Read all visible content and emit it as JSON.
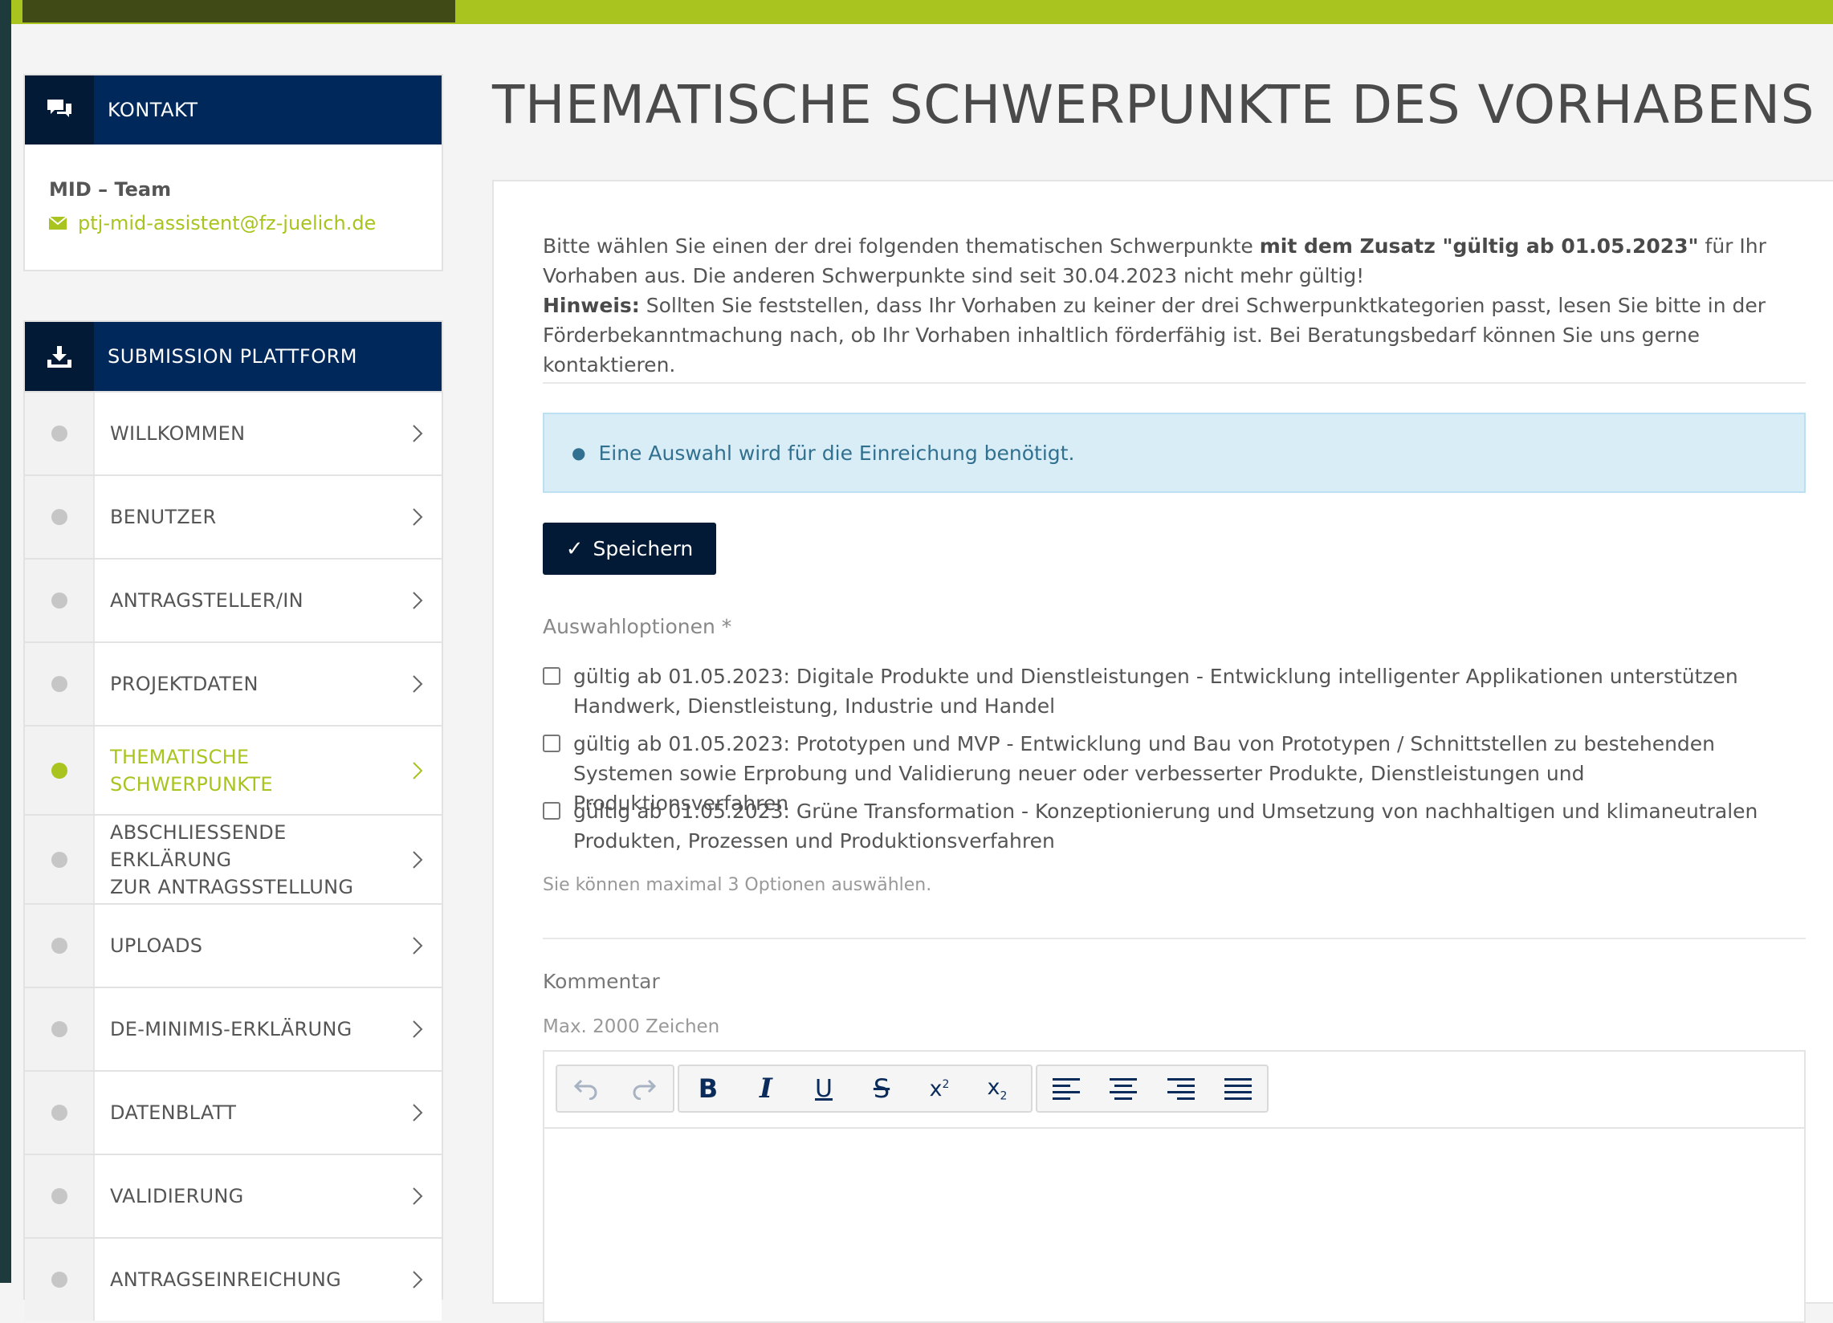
{
  "contact": {
    "header": "KONTAKT",
    "team": "MID – Team",
    "email": "ptj-mid-assistent@fz-juelich.de"
  },
  "submission": {
    "header": "SUBMISSION PLATTFORM",
    "items": [
      {
        "line1": "WILLKOMMEN",
        "line2": ""
      },
      {
        "line1": "BENUTZER",
        "line2": ""
      },
      {
        "line1": "ANTRAGSTELLER/IN",
        "line2": ""
      },
      {
        "line1": "PROJEKTDATEN",
        "line2": ""
      },
      {
        "line1": "THEMATISCHE",
        "line2": "SCHWERPUNKTE"
      },
      {
        "line1": "ABSCHLIESSENDE ERKLÄRUNG",
        "line2": "ZUR ANTRAGSSTELLUNG"
      },
      {
        "line1": "UPLOADS",
        "line2": ""
      },
      {
        "line1": "DE-MINIMIS-ERKLÄRUNG",
        "line2": ""
      },
      {
        "line1": "DATENBLATT",
        "line2": ""
      },
      {
        "line1": "VALIDIERUNG",
        "line2": ""
      },
      {
        "line1": "ANTRAGSEINREICHUNG",
        "line2": ""
      }
    ],
    "active_index": 4
  },
  "main": {
    "title": "THEMATISCHE SCHWERPUNKTE DES VORHABENS",
    "intro": {
      "p1_start": "Bitte wählen Sie einen der drei folgenden thematischen Schwerpunkte ",
      "p1_bold": "mit dem Zusatz \"gültig ab 01.05.2023\"",
      "p1_end": " für Ihr Vorhaben aus. Die anderen Schwerpunkte sind seit 30.04.2023 nicht mehr gültig!",
      "hint_label": "Hinweis:",
      "hint_text": " Sollten Sie feststellen, dass Ihr Vorhaben zu keiner der drei Schwerpunktkategorien passt, lesen Sie bitte in der Förderbekanntmachung nach, ob Ihr Vorhaben inhaltlich förderfähig ist. Bei Beratungsbedarf können Sie uns gerne kontaktieren."
    },
    "alert": "Eine Auswahl wird für die Einreichung benötigt.",
    "save_label": "Speichern",
    "options_label": "Auswahloptionen *",
    "options": [
      "gültig ab 01.05.2023: Digitale Produkte und Dienstleistungen - Entwicklung intelligenter Applikationen unterstützen Handwerk, Dienstleistung, Industrie und Handel",
      "gültig ab 01.05.2023: Prototypen und MVP - Entwicklung und Bau von Prototypen / Schnittstellen zu bestehenden Systemen sowie Erprobung und Validierung neuer oder verbesserter Produkte, Dienstleistungen und Produktionsverfahren",
      "gültig ab 01.05.2023: Grüne Transformation - Konzeptionierung und Umsetzung von nachhaltigen und klimaneutralen Produkten, Prozessen und Produktionsverfahren"
    ],
    "options_hint": "Sie können maximal 3 Optionen auswählen.",
    "comment_label": "Kommentar",
    "comment_hint": "Max. 2000 Zeichen",
    "comment_value": ""
  },
  "colors": {
    "brand_green": "#a9c41e",
    "navy": "#00285a",
    "dark_navy": "#021a36",
    "alert_bg": "#d9edf7",
    "alert_text": "#31708f"
  }
}
